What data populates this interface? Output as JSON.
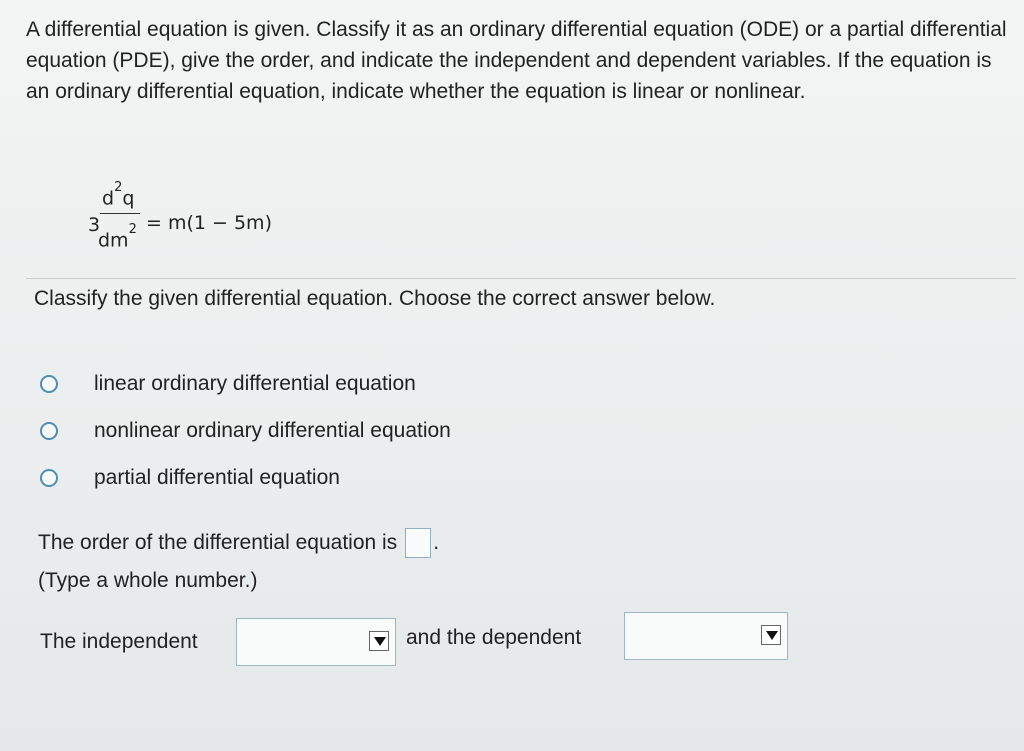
{
  "question": {
    "text": "A differential equation is given. Classify it as an ordinary differential equation (ODE) or a partial differential equation (PDE), give the order, and indicate the independent and dependent variables. If the equation is an ordinary differential equation, indicate whether the equation is linear or nonlinear."
  },
  "equation": {
    "coefficient": "3",
    "numerator": "d",
    "numerator_power": "2",
    "numerator_var": "q",
    "denominator": "dm",
    "denominator_power": "2",
    "rhs": "= m(1 − 5m)"
  },
  "prompt": "Classify the given differential equation. Choose the correct answer below.",
  "options": [
    {
      "label": "linear ordinary differential equation"
    },
    {
      "label": "nonlinear ordinary differential equation"
    },
    {
      "label": "partial differential equation"
    }
  ],
  "order": {
    "text": "The order of the differential equation is",
    "suffix": ".",
    "value": "",
    "hint": "(Type a whole number.)"
  },
  "variables": {
    "independent_label": "The independent",
    "dependent_label": "and the dependent",
    "independent_value": "",
    "dependent_value": ""
  },
  "colors": {
    "radio_border": "#4f8db4",
    "box_border": "#8fb0c4"
  },
  "icons": {
    "dropdown": "dropdown-arrow-icon"
  }
}
